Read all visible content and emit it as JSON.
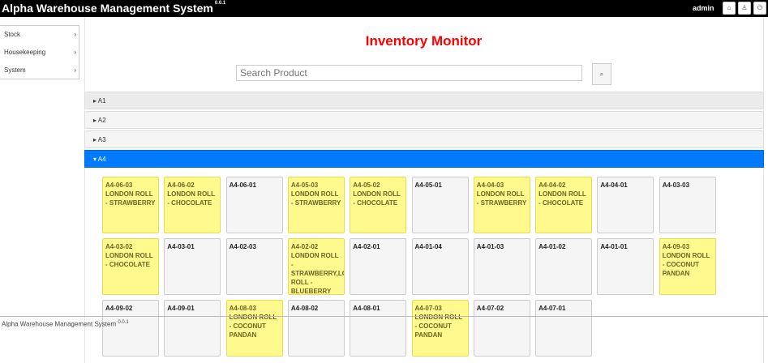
{
  "header": {
    "app_title": "Alpha Warehouse Management System",
    "version": "0.0.1",
    "user": "admin",
    "buttons": [
      {
        "icon": "home-icon",
        "glyph": "⌂"
      },
      {
        "icon": "user-icon",
        "glyph": "♙"
      },
      {
        "icon": "power-icon",
        "glyph": "⏻"
      }
    ]
  },
  "sidebar": {
    "items": [
      {
        "label": "Stock"
      },
      {
        "label": "Housekeeping"
      },
      {
        "label": "System"
      }
    ]
  },
  "main": {
    "title": "Inventory Monitor",
    "search": {
      "placeholder": "Search Product",
      "value": ""
    },
    "zones": [
      {
        "label": "A1",
        "open": false
      },
      {
        "label": "A2",
        "open": false
      },
      {
        "label": "A3",
        "open": false
      },
      {
        "label": "A4",
        "open": true
      }
    ],
    "locations": [
      {
        "code": "A4-06-03",
        "product": "LONDON ROLL - STRAWBERRY"
      },
      {
        "code": "A4-06-02",
        "product": "LONDON ROLL - CHOCOLATE"
      },
      {
        "code": "A4-06-01",
        "product": ""
      },
      {
        "code": "A4-05-03",
        "product": "LONDON ROLL - STRAWBERRY"
      },
      {
        "code": "A4-05-02",
        "product": "LONDON ROLL - CHOCOLATE"
      },
      {
        "code": "A4-05-01",
        "product": ""
      },
      {
        "code": "A4-04-03",
        "product": "LONDON ROLL - STRAWBERRY"
      },
      {
        "code": "A4-04-02",
        "product": "LONDON ROLL - CHOCOLATE"
      },
      {
        "code": "A4-04-01",
        "product": ""
      },
      {
        "code": "A4-03-03",
        "product": ""
      },
      {
        "code": "A4-03-02",
        "product": "LONDON ROLL - CHOCOLATE"
      },
      {
        "code": "A4-03-01",
        "product": ""
      },
      {
        "code": "A4-02-03",
        "product": ""
      },
      {
        "code": "A4-02-02",
        "product": "LONDON ROLL - STRAWBERRY,LONDON ROLL - BLUEBERRY"
      },
      {
        "code": "A4-02-01",
        "product": ""
      },
      {
        "code": "A4-01-04",
        "product": ""
      },
      {
        "code": "A4-01-03",
        "product": ""
      },
      {
        "code": "A4-01-02",
        "product": ""
      },
      {
        "code": "A4-01-01",
        "product": ""
      },
      {
        "code": "A4-09-03",
        "product": "LONDON ROLL - COCONUT PANDAN"
      },
      {
        "code": "A4-09-02",
        "product": ""
      },
      {
        "code": "A4-09-01",
        "product": ""
      },
      {
        "code": "A4-08-03",
        "product": "LONDON ROLL - COCONUT PANDAN"
      },
      {
        "code": "A4-08-02",
        "product": ""
      },
      {
        "code": "A4-08-01",
        "product": ""
      },
      {
        "code": "A4-07-03",
        "product": "LONDON ROLL - COCONUT PANDAN"
      },
      {
        "code": "A4-07-02",
        "product": ""
      },
      {
        "code": "A4-07-01",
        "product": ""
      }
    ]
  },
  "footer": {
    "text": "Alpha Warehouse Management System",
    "version": "0.0.1"
  },
  "colors": {
    "accent": "#007bff",
    "title": "#ff0000",
    "occupied": "#fff98e",
    "empty": "#f5f5f5"
  }
}
